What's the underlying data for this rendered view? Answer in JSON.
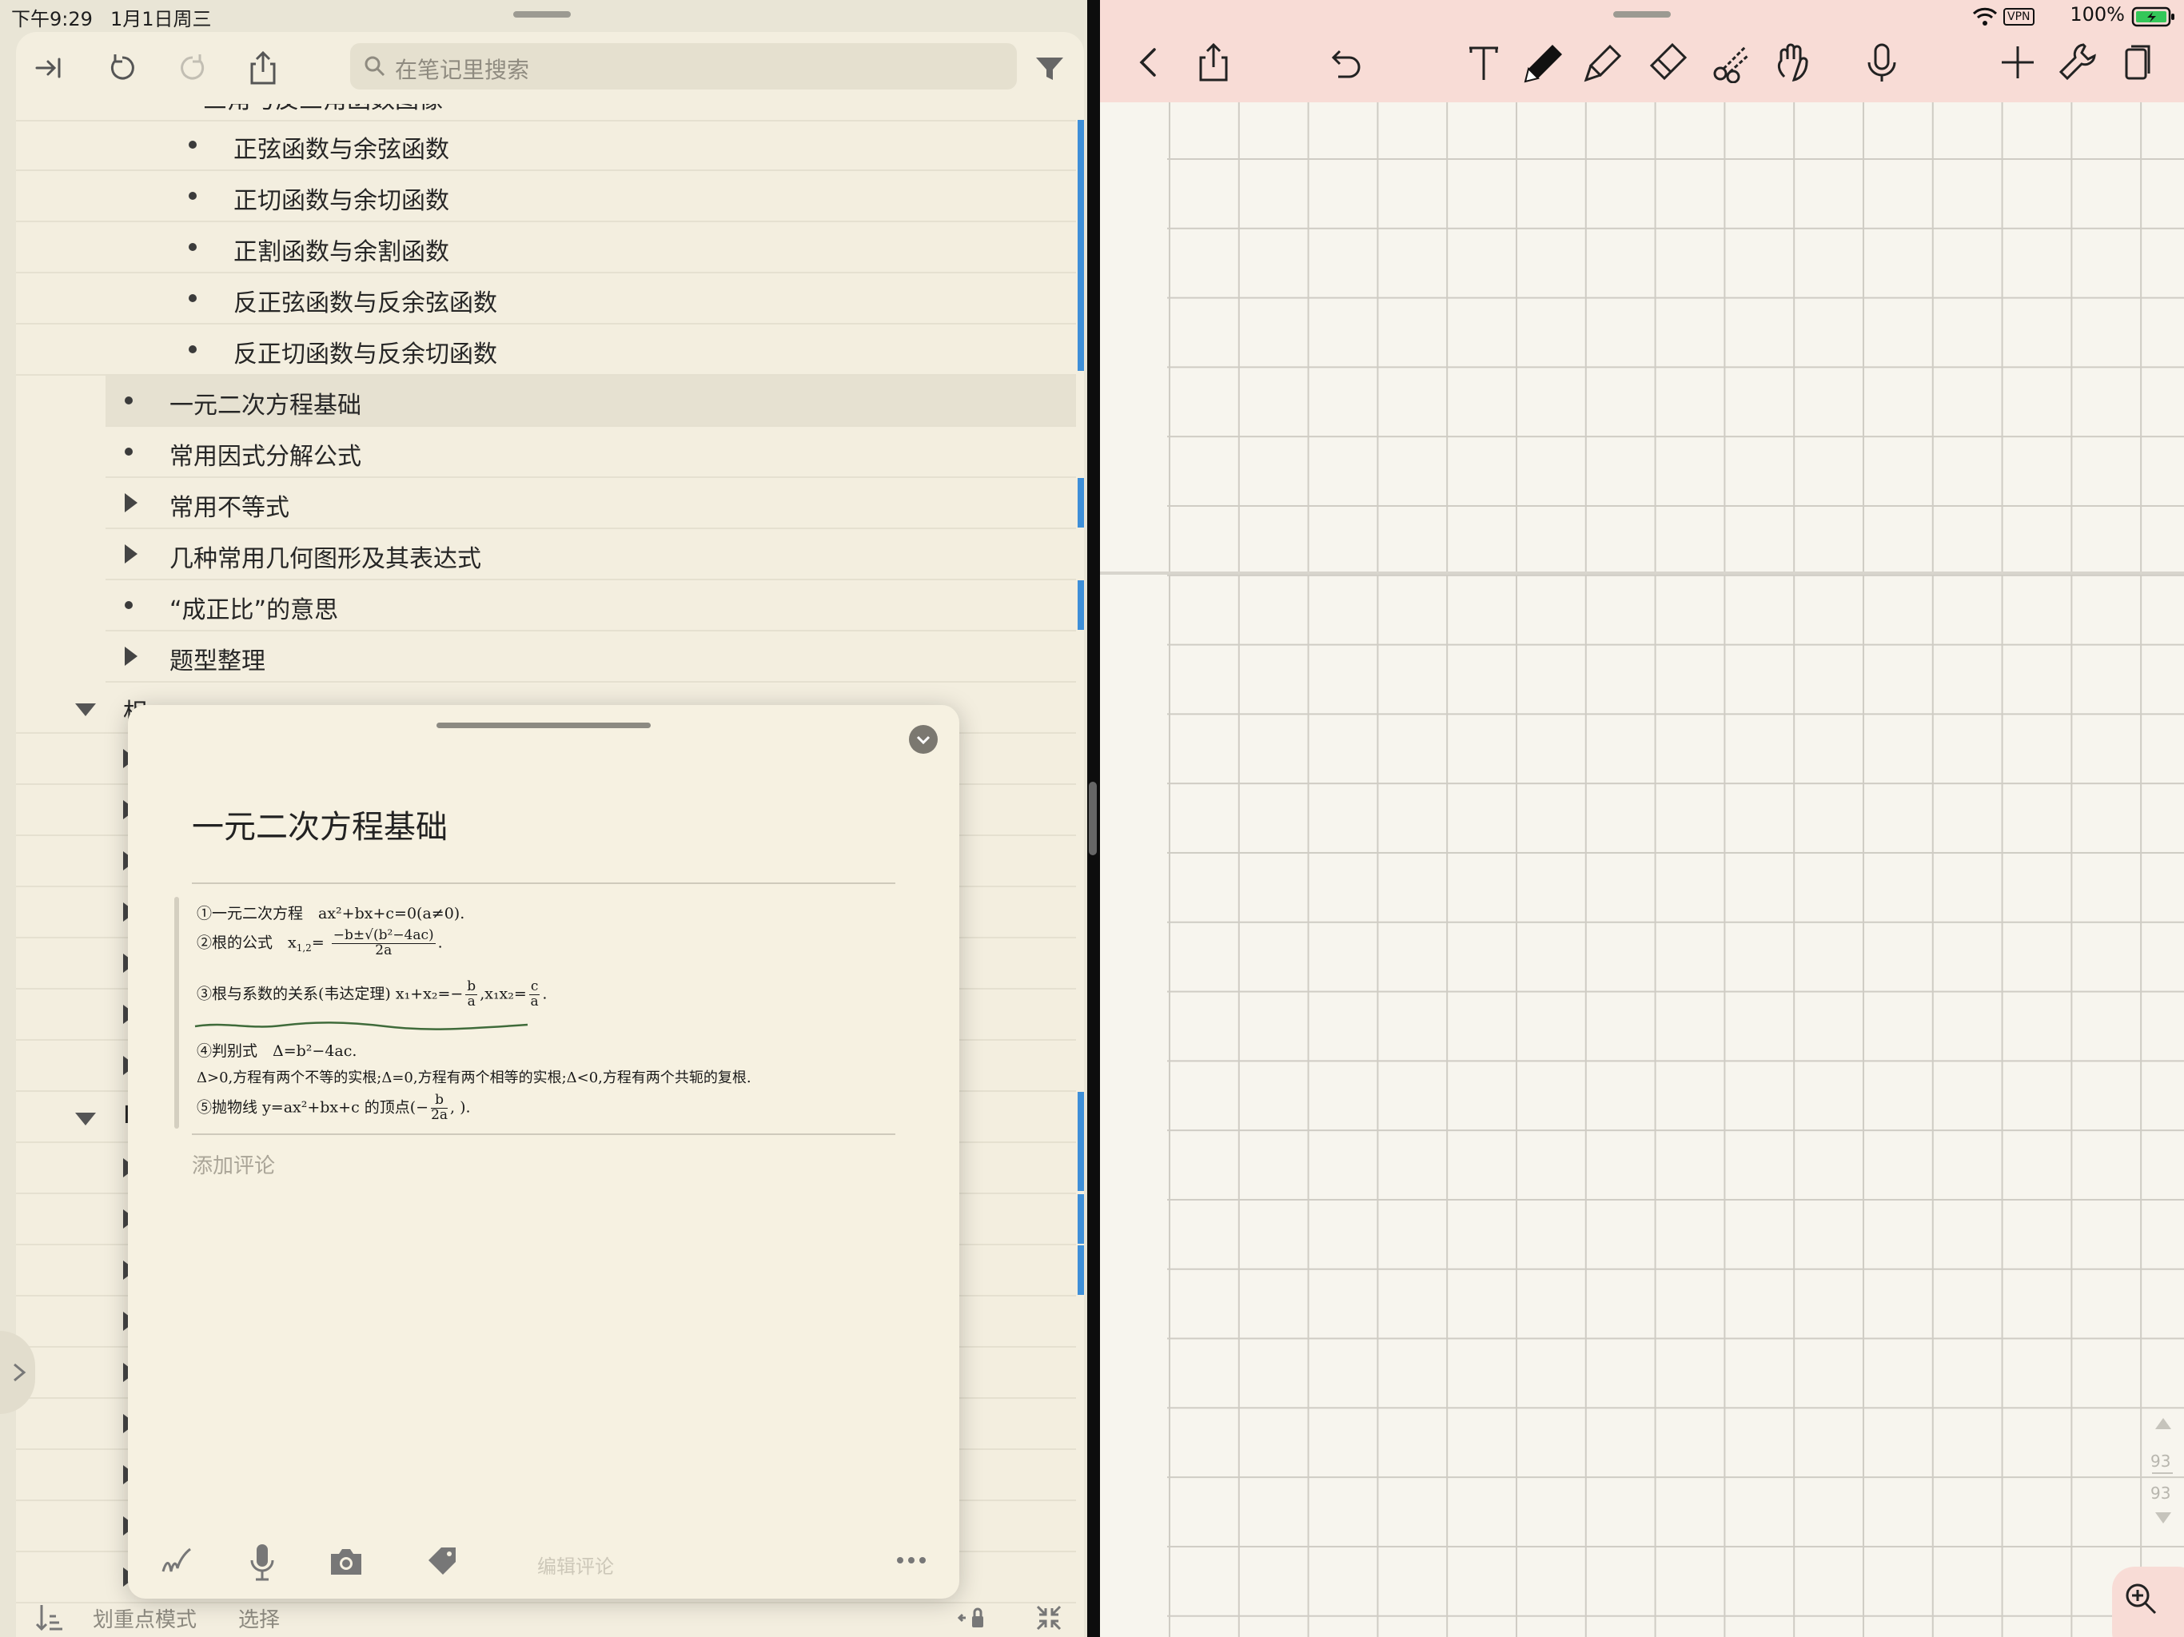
{
  "left_status": {
    "time": "下午9:29",
    "date": "1月1日周三"
  },
  "left_toolbar": {
    "search_placeholder": "在笔记里搜索"
  },
  "outline": {
    "partial_item": "三角与反三角函数图像",
    "subitems": [
      "正弦函数与余弦函数",
      "正切函数与余切函数",
      "正割函数与余割函数",
      "反正弦函数与反余弦函数",
      "反正切函数与反余切函数"
    ],
    "items": [
      "一元二次方程基础",
      "常用因式分解公式",
      "常用不等式",
      "几种常用几何图形及其表达式",
      "“成正比”的意思",
      "题型整理"
    ],
    "collapsed_heading_initial": "相",
    "collapsed_heading_initial_2": "I"
  },
  "left_bottom": {
    "highlight_mode": "划重点模式",
    "select": "选择"
  },
  "note": {
    "title": "一元二次方程基础",
    "formula": {
      "line1": "①一元二次方程　ax²+bx+c=0(a≠0).",
      "line2_prefix": "②根的公式　x",
      "line2_sub": "1,2",
      "line2_eq": "=",
      "line2_num": "−b±√(b²−4ac)",
      "line2_den": "2a",
      "line2_end": ".",
      "line3_prefix": "③根与系数的关系(韦达定理) x₁+x₂=−",
      "line3_frac1_num": "b",
      "line3_frac1_den": "a",
      "line3_mid": ",x₁x₂=",
      "line3_frac2_num": "c",
      "line3_frac2_den": "a",
      "line3_end": ".",
      "line4": "④判别式　Δ=b²−4ac.",
      "line5": "Δ>0,方程有两个不等的实根;Δ=0,方程有两个相等的实根;Δ<0,方程有两个共轭的复根.",
      "line6_prefix": "⑤抛物线 y=ax²+bx+c 的顶点(−",
      "line6_frac_num": "b",
      "line6_frac_den": "2a",
      "line6_end": ",  ).",
      "underline_color": "#3f6b3a"
    },
    "add_comment": "添加评论",
    "edit_comment": "编辑评论"
  },
  "right_status": {
    "vpn": "VPN",
    "battery": "100%"
  },
  "right_page": {
    "page_current": "93",
    "page_total": "93"
  },
  "colors": {
    "left_bg": "#f3eedf",
    "right_toolbar": "#f8dcd6",
    "accent_blue": "#3e8fd8",
    "battery_green": "#34c759"
  }
}
